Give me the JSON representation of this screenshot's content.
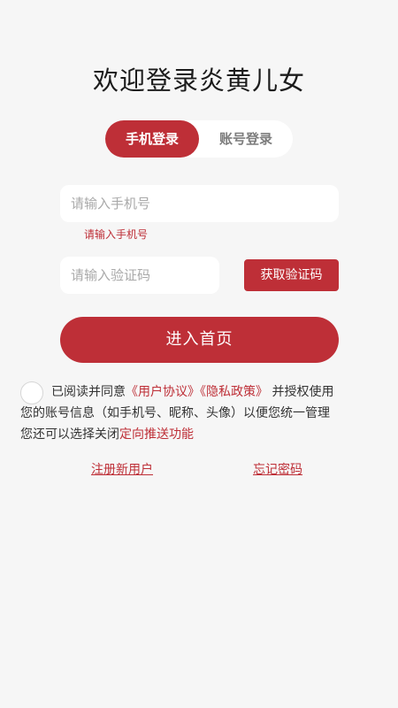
{
  "title": "欢迎登录炎黄儿女",
  "tabs": [
    {
      "label": "手机登录",
      "active": true
    },
    {
      "label": "账号登录",
      "active": false
    }
  ],
  "phone": {
    "placeholder": "请输入手机号",
    "value": "",
    "error": "请输入手机号"
  },
  "code": {
    "placeholder": "请输入验证码",
    "value": "",
    "button": "获取验证码"
  },
  "enter_button": "进入首页",
  "agreement": {
    "checked": false,
    "line1_pre": "已阅读并同意",
    "user_agreement": "《用户协议》",
    "privacy_policy": "《隐私政策》",
    "line1_post": "并授权使用",
    "line2": "您的账号信息（如手机号、昵称、头像）以便您统一管理",
    "line3_pre": "您还可以选择关闭",
    "push_link": "定向推送功能"
  },
  "links": {
    "register": "注册新用户",
    "forgot": "忘记密码"
  },
  "colors": {
    "accent": "#be2f37",
    "background": "#f6f6f6",
    "inactive_text": "#7d7d7d"
  }
}
